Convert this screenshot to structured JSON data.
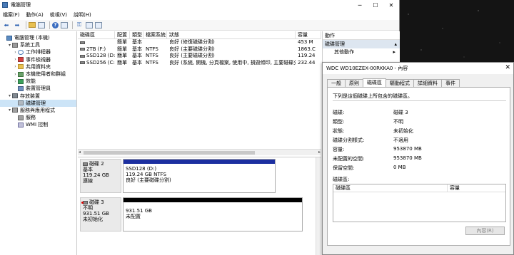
{
  "window": {
    "title": "電腦管理"
  },
  "menu": [
    "檔案(F)",
    "動作(A)",
    "檢視(V)",
    "說明(H)"
  ],
  "tree": [
    {
      "label": "電腦管理 (本機)",
      "indent": 0,
      "arrow": "",
      "icon": "computer"
    },
    {
      "label": "系統工具",
      "indent": 1,
      "arrow": "▾",
      "icon": "tool"
    },
    {
      "label": "工作排程器",
      "indent": 2,
      "arrow": "›",
      "icon": "clock"
    },
    {
      "label": "事件檢視器",
      "indent": 2,
      "arrow": "›",
      "icon": "event"
    },
    {
      "label": "共用資料夾",
      "indent": 2,
      "arrow": "›",
      "icon": "folder"
    },
    {
      "label": "本機使用者和群組",
      "indent": 2,
      "arrow": "›",
      "icon": "users"
    },
    {
      "label": "效能",
      "indent": 2,
      "arrow": "›",
      "icon": "perf"
    },
    {
      "label": "裝置管理員",
      "indent": 2,
      "arrow": "",
      "icon": "dev"
    },
    {
      "label": "存放裝置",
      "indent": 1,
      "arrow": "▾",
      "icon": "storage"
    },
    {
      "label": "磁碟管理",
      "indent": 2,
      "arrow": "",
      "icon": "disk",
      "selected": true
    },
    {
      "label": "服務與應用程式",
      "indent": 1,
      "arrow": "▾",
      "icon": "svc"
    },
    {
      "label": "服務",
      "indent": 2,
      "arrow": "",
      "icon": "svc"
    },
    {
      "label": "WMI 控制",
      "indent": 2,
      "arrow": "",
      "icon": "wmi"
    }
  ],
  "volume_table": {
    "headers": [
      "磁碟區",
      "配置",
      "類型",
      "檔案系統",
      "狀態",
      "容量"
    ],
    "rows": [
      [
        "",
        "簡單",
        "基本",
        "",
        "良好 (修復磁碟分割)",
        "453 M"
      ],
      [
        "2TB (F:)",
        "簡單",
        "基本",
        "NTFS",
        "良好 (主要磁碟分割)",
        "1863.C"
      ],
      [
        "SSD128 (D:)",
        "簡單",
        "基本",
        "NTFS",
        "良好 (主要磁碟分割)",
        "119.24"
      ],
      [
        "SSD256 (C:)",
        "簡單",
        "基本",
        "NTFS",
        "良好 (系統, 開機, 分頁檔案, 使用中, 損毀傾印, 主要磁碟分割)",
        "232.44"
      ]
    ]
  },
  "disks": [
    {
      "name": "磁碟 2",
      "type": "基本",
      "size": "119.24 GB",
      "status": "連線",
      "part_name": "SSD128 (D:)",
      "part_line2": "119.24 GB NTFS",
      "part_line3": "良好 (主要磁碟分割)"
    },
    {
      "name": "磁碟 3",
      "type": "不明",
      "size": "931.51 GB",
      "status": "未初始化",
      "part_name": "",
      "part_line2": "931.51 GB",
      "part_line3": "未配置"
    }
  ],
  "actions": {
    "header": "動作",
    "section": "磁碟管理",
    "item": "其他動作"
  },
  "dialog": {
    "title": "WDC WD10EZEX-00RKKA0 - 內容",
    "tabs": [
      "一般",
      "原則",
      "磁碟區",
      "驅動程式",
      "詳細資料",
      "事件"
    ],
    "active_tab": 2,
    "description": "下列是這個磁碟上所包含的磁碟區。",
    "props": [
      [
        "磁碟:",
        "磁碟 3"
      ],
      [
        "類型:",
        "不明"
      ],
      [
        "狀態:",
        "未初始化"
      ],
      [
        "磁碟分割樣式:",
        "不適用"
      ],
      [
        "容量:",
        "953870 MB"
      ],
      [
        "未配置的空間:",
        "953870 MB"
      ],
      [
        "保留空間:",
        "0 MB"
      ]
    ],
    "volumes_label": "磁碟區:",
    "volumes_headers": [
      "磁碟區",
      "容量"
    ],
    "properties_button": "內容(R)"
  }
}
